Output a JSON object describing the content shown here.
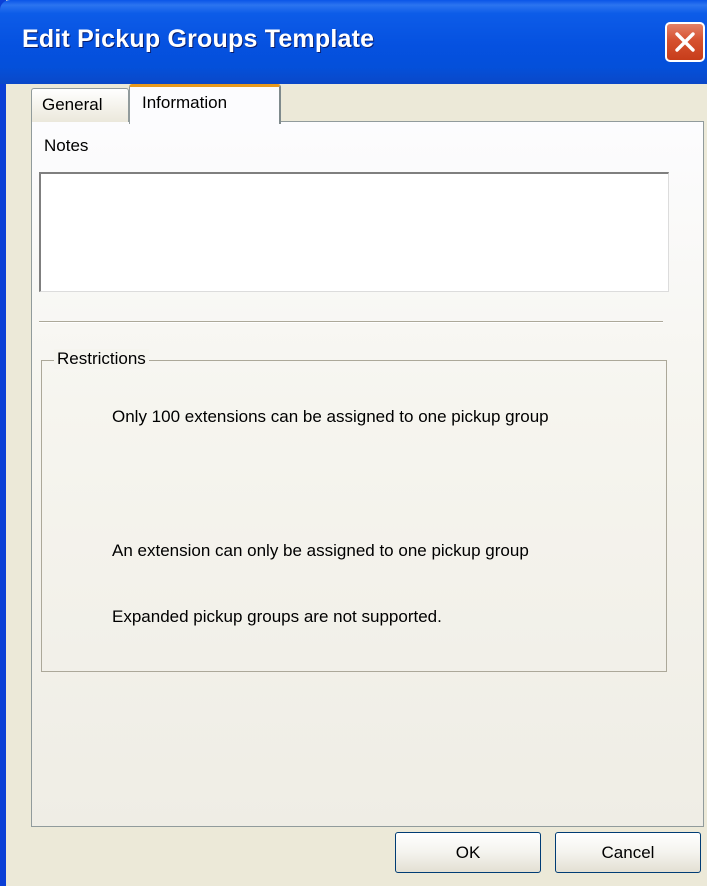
{
  "window": {
    "title": "Edit Pickup Groups Template",
    "close_icon": "close-icon"
  },
  "tabs": [
    {
      "label": "General",
      "selected": false
    },
    {
      "label": "Information",
      "selected": true
    }
  ],
  "notes": {
    "label": "Notes",
    "value": ""
  },
  "restrictions": {
    "legend": "Restrictions",
    "items": [
      "Only 100 extensions can be assigned to one pickup group",
      "An extension can only be assigned to one pickup group",
      "Expanded pickup groups are not supported."
    ]
  },
  "buttons": {
    "ok": "OK",
    "cancel": "Cancel"
  },
  "colors": {
    "titlebar": "#0551e0",
    "face": "#ece9d8",
    "close": "#d6512f",
    "active_tab_highlight": "#e89a1e"
  }
}
